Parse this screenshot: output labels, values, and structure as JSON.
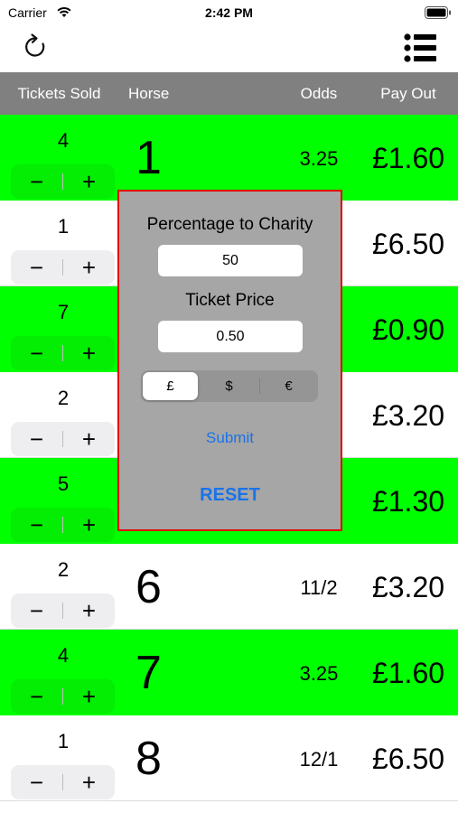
{
  "status_bar": {
    "carrier": "Carrier",
    "time": "2:42 PM"
  },
  "nav": {
    "left_icon": "refresh-icon",
    "right_icon": "list-icon"
  },
  "table": {
    "headers": {
      "tickets_sold": "Tickets Sold",
      "horse": "Horse",
      "odds": "Odds",
      "payout": "Pay Out"
    },
    "rows": [
      {
        "sold": "4",
        "horse": "1",
        "odds": "3.25",
        "payout": "£1.60",
        "highlight": true
      },
      {
        "sold": "1",
        "horse": "",
        "odds": "",
        "payout": "£6.50",
        "highlight": false
      },
      {
        "sold": "7",
        "horse": "",
        "odds": "",
        "payout": "£0.90",
        "highlight": true
      },
      {
        "sold": "2",
        "horse": "",
        "odds": "",
        "payout": "£3.20",
        "highlight": false
      },
      {
        "sold": "5",
        "horse": "",
        "odds": "",
        "payout": "£1.30",
        "highlight": true
      },
      {
        "sold": "2",
        "horse": "6",
        "odds": "11/2",
        "payout": "£3.20",
        "highlight": false
      },
      {
        "sold": "4",
        "horse": "7",
        "odds": "3.25",
        "payout": "£1.60",
        "highlight": true
      },
      {
        "sold": "1",
        "horse": "8",
        "odds": "12/1",
        "payout": "£6.50",
        "highlight": false
      }
    ],
    "stepper": {
      "minus": "−",
      "plus": "+"
    }
  },
  "dialog": {
    "charity_label": "Percentage to Charity",
    "charity_value": "50",
    "price_label": "Ticket Price",
    "price_value": "0.50",
    "currencies": [
      "£",
      "$",
      "€"
    ],
    "selected_currency": "£",
    "submit_label": "Submit",
    "reset_label": "RESET"
  },
  "colors": {
    "highlight_row": "#00ff00",
    "header_bg": "#808080",
    "dialog_bg": "#a6a6a6",
    "dialog_border": "#e00000",
    "link": "#1a73e8"
  }
}
